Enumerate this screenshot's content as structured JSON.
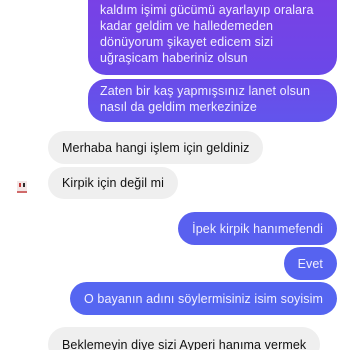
{
  "messages": {
    "sent_top": "kaldım işimi gücümü ayarlayıp oralara kadar geldim ve halledemeden dönüyorum şikayet edicem sizi uğraşicam haberiniz olsun",
    "sent_second": "Zaten bir kaş yapmışsınız lanet olsun nasıl da geldim merkezinize",
    "received_first": "Merhaba hangi işlem için geldiniz",
    "received_second": "Kirpik için değil mi",
    "sent_third": "İpek kirpik hanımefendi",
    "sent_fourth": "Evet",
    "sent_fifth": "O bayanın adını söylermisiniz isim soyisim",
    "received_third": "Beklemeyin diye sizi Ayperi hanıma vermek"
  },
  "colors": {
    "sent_bubble": "#6a4ee6",
    "received_bubble": "#efefef"
  },
  "icons": {
    "avatar": "profile-avatar"
  }
}
